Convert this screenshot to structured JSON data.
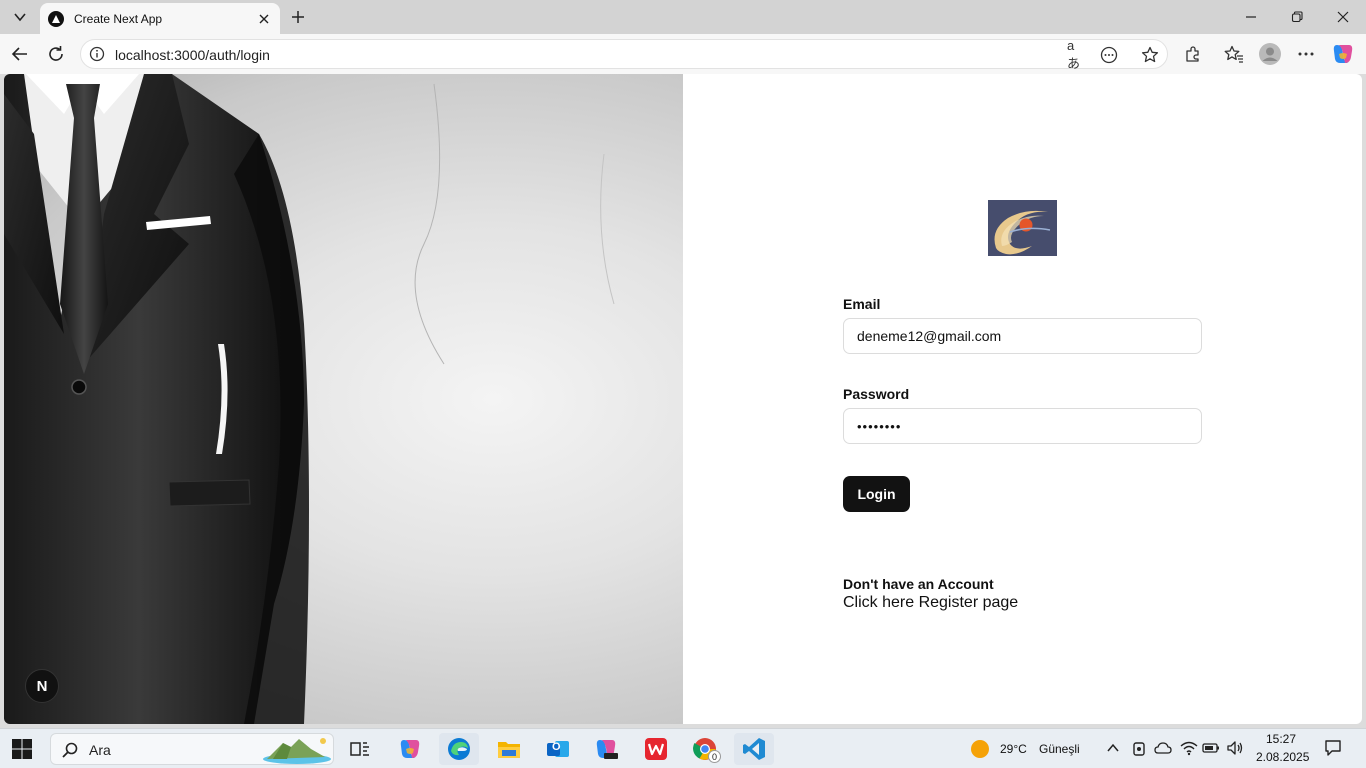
{
  "browser": {
    "tab_title": "Create Next App",
    "url": "localhost:3000/auth/login",
    "translate_glyph": "aあ"
  },
  "page": {
    "form": {
      "email_label": "Email",
      "email_value": "deneme12@gmail.com",
      "password_label": "Password",
      "password_value": "••••••••",
      "login_button": "Login",
      "no_account_text": "Don't have an Account",
      "register_link": "Click here Register page"
    },
    "next_badge": "N"
  },
  "taskbar": {
    "search_label": "Ara",
    "weather_temp": "29°C",
    "weather_desc": "Güneşli",
    "time": "15:27",
    "date": "2.08.2025",
    "outlook_letter": "O",
    "chrome_badge": "0"
  },
  "colors": {
    "login_button": "#121212",
    "tab_strip": "#d3d3d3",
    "edge_blue": "#0c7bd4",
    "vscode_blue": "#1f8ad2"
  },
  "icons": [
    "tab-list-icon",
    "next-favicon",
    "close-icon",
    "plus-icon",
    "minimize-icon",
    "restore-icon",
    "back-icon",
    "refresh-icon",
    "info-icon",
    "translate-icon",
    "reading-mode-icon",
    "favorite-star-icon",
    "extensions-icon",
    "favorites-icon",
    "profile-icon",
    "more-icon",
    "copilot-icon",
    "windows-icon",
    "search-icon",
    "task-view-icon",
    "edge-icon",
    "file-explorer-icon",
    "outlook-icon",
    "word-icon",
    "chrome-icon",
    "vscode-icon",
    "sun-icon",
    "chevron-up-icon",
    "wifi-icon",
    "battery-icon",
    "volume-icon",
    "notification-icon"
  ]
}
